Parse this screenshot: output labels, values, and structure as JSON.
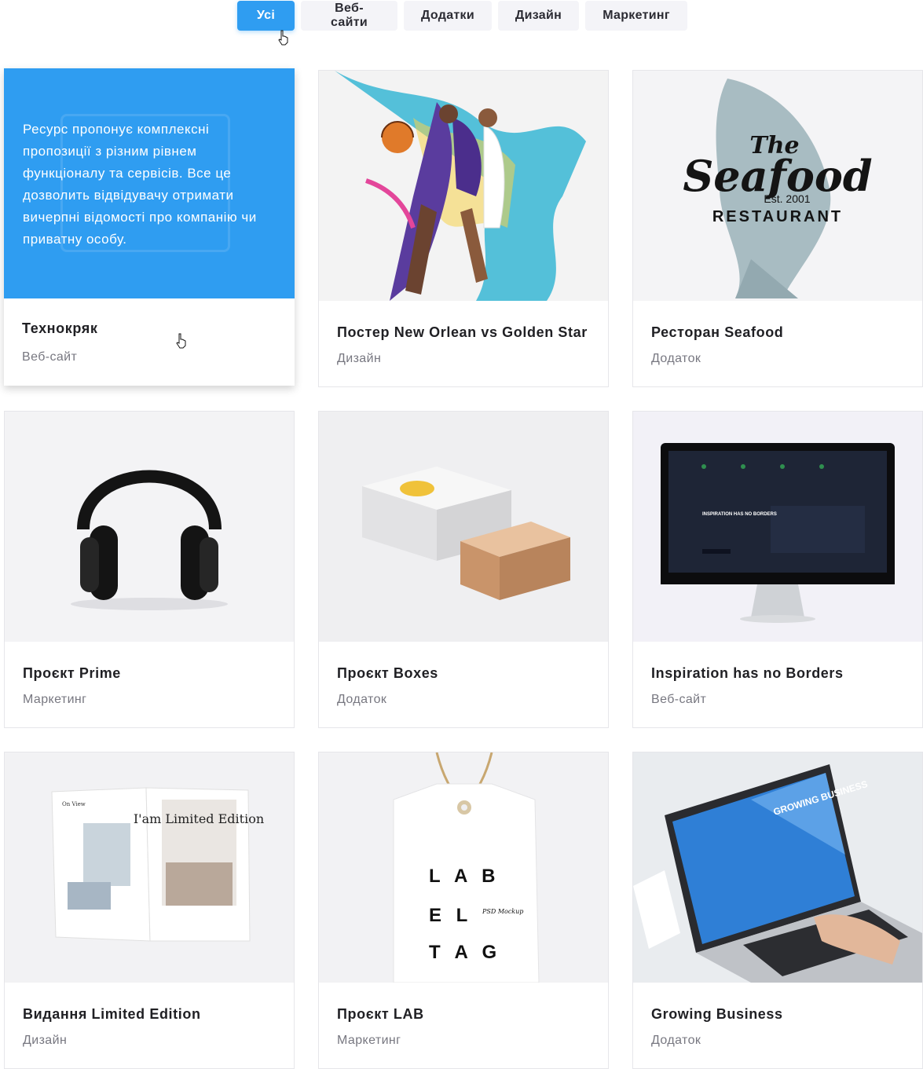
{
  "filters": [
    {
      "label": "Усі",
      "active": true
    },
    {
      "label": "Веб-сайти",
      "active": false
    },
    {
      "label": "Додатки",
      "active": false
    },
    {
      "label": "Дизайн",
      "active": false
    },
    {
      "label": "Маркетинг",
      "active": false
    }
  ],
  "cards": [
    {
      "title": "Технокряк",
      "category": "Веб-сайт",
      "overlay_text": "Ресурс пропонує комплексні пропозиції з різним рівнем функціоналу та сервісів. Все це дозволить відвідувачу отримати вичерпні відомості про компанію чи приватну особу."
    },
    {
      "title": "Постер New Orlean vs Golden Star",
      "category": "Дизайн"
    },
    {
      "title": "Ресторан Seafood",
      "category": "Додаток",
      "image_text": {
        "the": "The",
        "main": "Seafood",
        "est": "Est. 2001",
        "sub": "RESTAURANT"
      }
    },
    {
      "title": "Проєкт Prime",
      "category": "Маркетинг"
    },
    {
      "title": "Проєкт Boxes",
      "category": "Додаток"
    },
    {
      "title": "Inspiration has no Borders",
      "category": "Веб-сайт",
      "image_text": {
        "headline": "INSPIRATION HAS NO BORDERS"
      }
    },
    {
      "title": "Видання Limited Edition",
      "category": "Дизайн",
      "image_text": {
        "page": "On View",
        "cover": "I'am Limited Edition"
      }
    },
    {
      "title": "Проєкт LAB",
      "category": "Маркетинг",
      "image_text": {
        "l1": "L A B",
        "l2": "E L",
        "l3": "T A G",
        "side": "PSD Mockup"
      }
    },
    {
      "title": "Growing Business",
      "category": "Додаток",
      "image_text": {
        "headline": "GROWING BUSINESS"
      }
    }
  ],
  "colors": {
    "accent": "#2f9df1",
    "filter_bg": "#f4f4f8"
  }
}
